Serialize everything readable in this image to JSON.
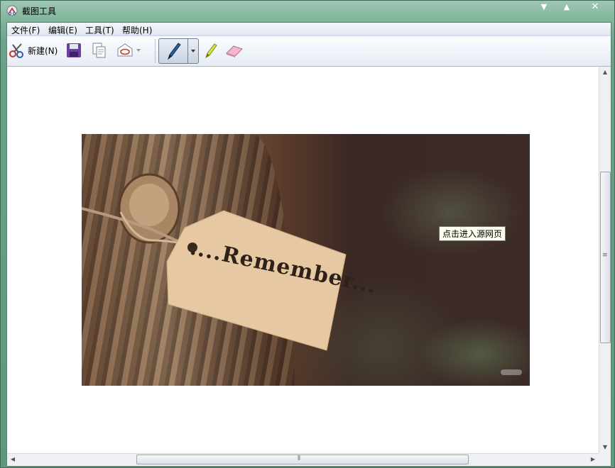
{
  "window": {
    "title": "截图工具"
  },
  "menu": [
    {
      "label": "文件(F)"
    },
    {
      "label": "编辑(E)"
    },
    {
      "label": "工具(T)"
    },
    {
      "label": "帮助(H)"
    }
  ],
  "toolbar": {
    "new_label": "新建(N)",
    "icons": [
      "scissors-icon",
      "save-icon",
      "copy-icon",
      "send-email-icon",
      "pen-icon",
      "highlighter-icon",
      "eraser-icon"
    ]
  },
  "content": {
    "image_text": "....Remember...",
    "tooltip": "点击进入源网页"
  },
  "colors": {
    "accent": "#dfe6f1",
    "tooltip_bg": "#fffff0"
  }
}
